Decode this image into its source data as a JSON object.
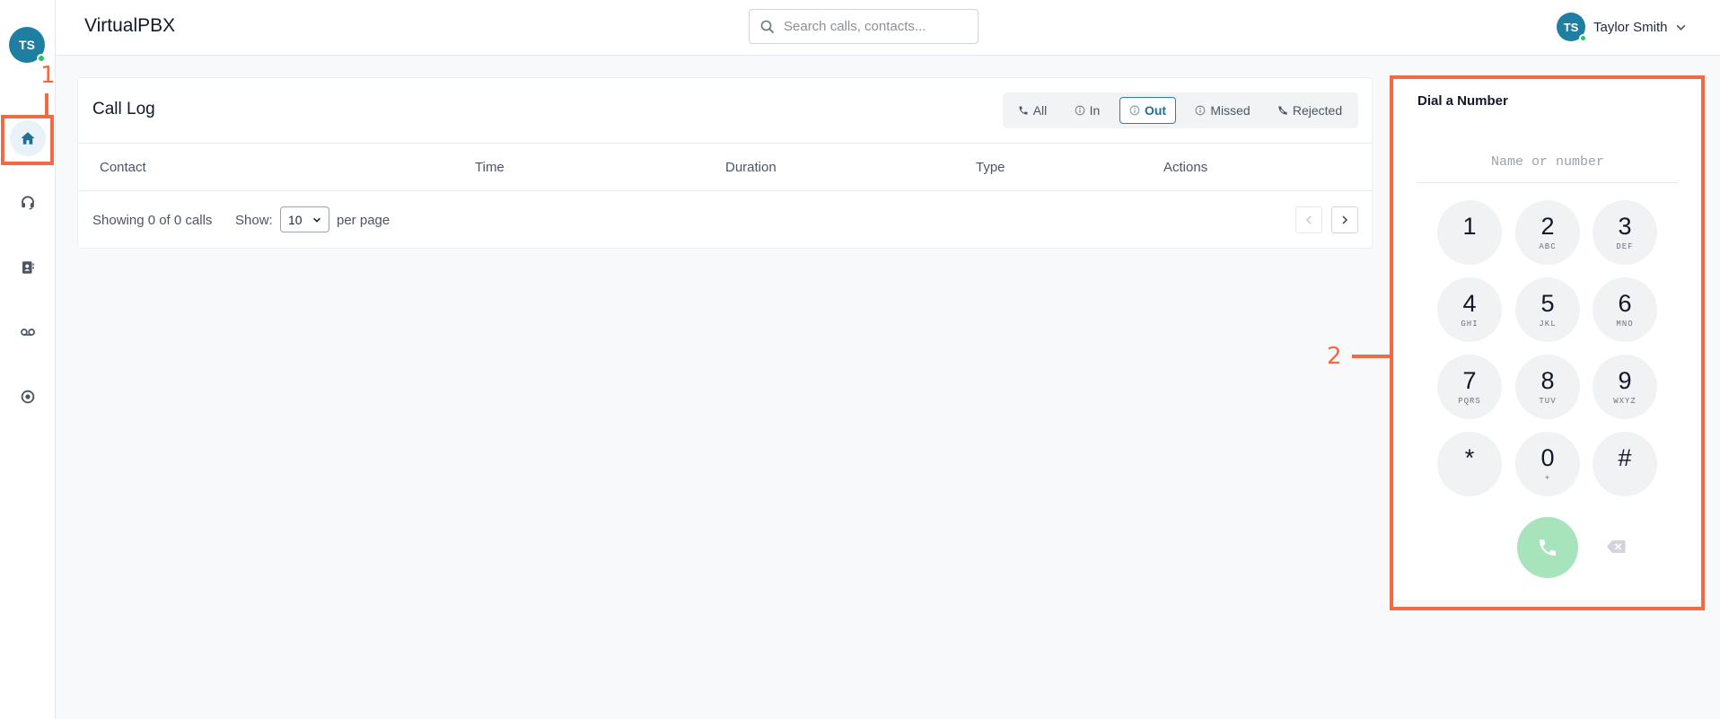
{
  "app": {
    "title": "VirtualPBX"
  },
  "sidebar": {
    "avatar_initials": "TS",
    "items": [
      {
        "id": "home",
        "icon": "home-icon",
        "active": true
      },
      {
        "id": "support",
        "icon": "headset-icon",
        "active": false
      },
      {
        "id": "contacts",
        "icon": "contacts-book-icon",
        "active": false
      },
      {
        "id": "voicemail",
        "icon": "voicemail-icon",
        "active": false
      },
      {
        "id": "settings",
        "icon": "target-icon",
        "active": false
      }
    ]
  },
  "header": {
    "search": {
      "placeholder": "Search calls, contacts...",
      "value": ""
    },
    "user": {
      "initials": "TS",
      "name": "Taylor Smith"
    }
  },
  "call_log": {
    "title": "Call Log",
    "filters": [
      {
        "label": "All",
        "active": false
      },
      {
        "label": "In",
        "active": false
      },
      {
        "label": "Out",
        "active": true
      },
      {
        "label": "Missed",
        "active": false
      },
      {
        "label": "Rejected",
        "active": false
      }
    ],
    "columns": [
      "Contact",
      "Time",
      "Duration",
      "Type",
      "Actions"
    ],
    "rows": [],
    "footer": {
      "showing": "Showing 0 of 0 calls",
      "show_label": "Show:",
      "per_page_value": "10",
      "per_page_label": "per page"
    }
  },
  "dialer": {
    "title": "Dial a Number",
    "input_placeholder": "Name or number",
    "keys": [
      {
        "digit": "1",
        "letters": ""
      },
      {
        "digit": "2",
        "letters": "ABC"
      },
      {
        "digit": "3",
        "letters": "DEF"
      },
      {
        "digit": "4",
        "letters": "GHI"
      },
      {
        "digit": "5",
        "letters": "JKL"
      },
      {
        "digit": "6",
        "letters": "MNO"
      },
      {
        "digit": "7",
        "letters": "PQRS"
      },
      {
        "digit": "8",
        "letters": "TUV"
      },
      {
        "digit": "9",
        "letters": "WXYZ"
      },
      {
        "digit": "*",
        "letters": ""
      },
      {
        "digit": "0",
        "letters": "+"
      },
      {
        "digit": "#",
        "letters": ""
      }
    ]
  },
  "annotations": {
    "label_1": "1",
    "label_2": "2",
    "color": "#f06a45"
  },
  "colors": {
    "brand": "#1f7fa3",
    "online": "#22c55e",
    "call_button": "#a7e4bc"
  }
}
